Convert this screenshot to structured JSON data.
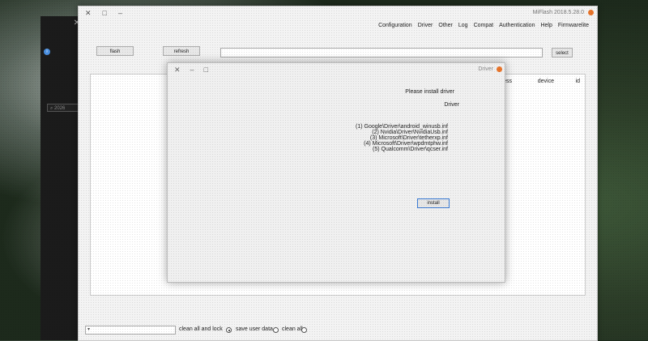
{
  "terminal": {
    "close_icon": "✕",
    "search_placeholder": "2026"
  },
  "main": {
    "title": "MiFlash 2018.5.28.0",
    "menu": [
      "Configuration",
      "Driver",
      "Other",
      "Log",
      "Compat",
      "Authentication",
      "Help",
      "Firmwarelite"
    ],
    "select_label": "select",
    "refresh_label": "refresh",
    "flash_label": "flash",
    "columns": [
      "id",
      "device",
      "progress"
    ],
    "bottom": {
      "clean_all": "clean all",
      "save_user_data": "save user data",
      "clean_all_and_lock": "clean all and lock",
      "selected": "clean_all_and_lock"
    }
  },
  "dialog": {
    "title": "Driver",
    "prompt": "Please install driver",
    "heading": "Driver",
    "lines": [
      "(1) Google\\Driver\\android_winusb.inf",
      "(2) Nvidia\\Driver\\NvidiaUsb.inf",
      "(3) Microsoft\\Driver\\tetherxp.inf",
      "(4) Microsoft\\Driver\\wpdmtphw.inf",
      "(5) Qualcomm\\Driver\\qcser.inf"
    ],
    "install_label": "install"
  },
  "colors": {
    "accent": "#3a7bd5",
    "app_icon": "#e8742a"
  }
}
